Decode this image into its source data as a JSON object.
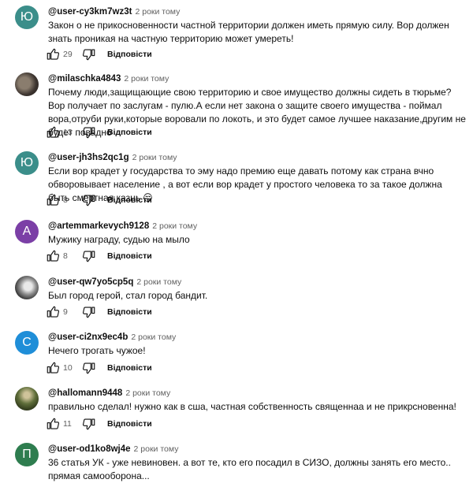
{
  "comments": [
    {
      "author": "@user-cy3km7wz3t",
      "time": "2 роки тому",
      "avatar_letter": "Ю",
      "avatar_color": "#3b8e8a",
      "text": "Закон о не прикосновенности частной территории должен иметь прямую силу. Вор должен знать проникая на частную территорию может умереть!",
      "likes": "29",
      "reply_label": "Відповісти"
    },
    {
      "author": "@milaschka4843",
      "time": "2 роки тому",
      "avatar_letter": "",
      "avatar_color": "#3d3530",
      "text": "Почему люди,защищающие свою территорию и свое имущество должны сидеть в тюрьме? Вор получает по заслугам - пулю.А если нет закона о защите своего имущества - поймал вора,отруби руки,которые воровали по локоть, и это будет самое лучшее наказание,другим не будет повадно",
      "likes": "13",
      "reply_label": "Відповісти"
    },
    {
      "author": "@user-jh3hs2qc1g",
      "time": "2 роки тому",
      "avatar_letter": "Ю",
      "avatar_color": "#3b8e8a",
      "text": "Если вор крадет у государства то эму надо премию еще давать потому как страна вчно обворовывает население , а вот если вор крадет у простого человека то за такое должна быть смертная казнь 😒",
      "likes": "8",
      "reply_label": "Відповісти"
    },
    {
      "author": "@artemmarkevych9128",
      "time": "2 роки тому",
      "avatar_letter": "A",
      "avatar_color": "#7b3fa6",
      "text": "Мужику награду, судью на мыло",
      "likes": "8",
      "reply_label": "Відповісти"
    },
    {
      "author": "@user-qw7yo5cp5q",
      "time": "2 роки тому",
      "avatar_letter": "",
      "avatar_color": "#8b8b8b",
      "text": "Был город герой, стал город бандит.",
      "likes": "9",
      "reply_label": "Відповісти"
    },
    {
      "author": "@user-ci2nx9ec4b",
      "time": "2 роки тому",
      "avatar_letter": "C",
      "avatar_color": "#1f8ed8",
      "text": "Нечего трогать чужое!",
      "likes": "10",
      "reply_label": "Відповісти"
    },
    {
      "author": "@hallomann9448",
      "time": "2 роки тому",
      "avatar_letter": "",
      "avatar_color": "#5f6e3a",
      "text": "правильно сделал! нужно как в сша, частная собственность священнаа и не прикрсновенна!",
      "likes": "11",
      "reply_label": "Відповісти"
    },
    {
      "author": "@user-od1ko8wj4e",
      "time": "2 роки тому",
      "avatar_letter": "П",
      "avatar_color": "#2e7d4f",
      "text": "36 статья УК - уже невиновен. а вот те, кто его посадил в СИЗО, должны занять его место.. прямая самооборона...",
      "likes": "",
      "reply_label": ""
    }
  ]
}
